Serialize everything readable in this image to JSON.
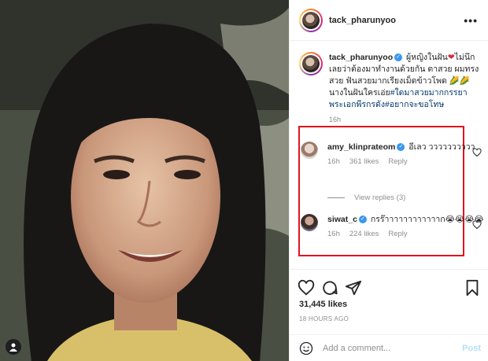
{
  "post": {
    "username": "tack_pharunyoo",
    "more_icon": "more-horizontal-icon",
    "caption": {
      "username": "tack_pharunyoo",
      "text_part1": "ผู้หญิงในฝัน",
      "text_part2": "ไม่นึกเลยว่าต้องมาทำงานด้วยกัน ตาสวย ผมทรงสวย ฟันสวยมากเรียงเม็ดข้าวโพด",
      "text_part3": "นางในฝันใครเอ่ย",
      "hashtags": "#ใดมาสวยมากกรรยาพระเอกพีรกรดัง#อยากจะขอโทษ",
      "time": "16h"
    },
    "comments": [
      {
        "username": "amy_klinprateom",
        "text": "อีเลว วววววววววว",
        "time": "16h",
        "likes": "361 likes",
        "reply": "Reply"
      },
      {
        "username": "siwat_c",
        "text": "กรร๊าาาาาาาาาาาาก",
        "time": "16h",
        "likes": "224 likes",
        "reply": "Reply"
      }
    ],
    "view_replies": "View replies (3)",
    "likes_count": "31,445 likes",
    "posted_ago": "18 HOURS AGO",
    "add_comment_placeholder": "Add a comment...",
    "post_button": "Post"
  },
  "colors": {
    "highlight_border": "#e0141e",
    "verified": "#3897f0",
    "post_button_disabled": "#b2dffc"
  }
}
